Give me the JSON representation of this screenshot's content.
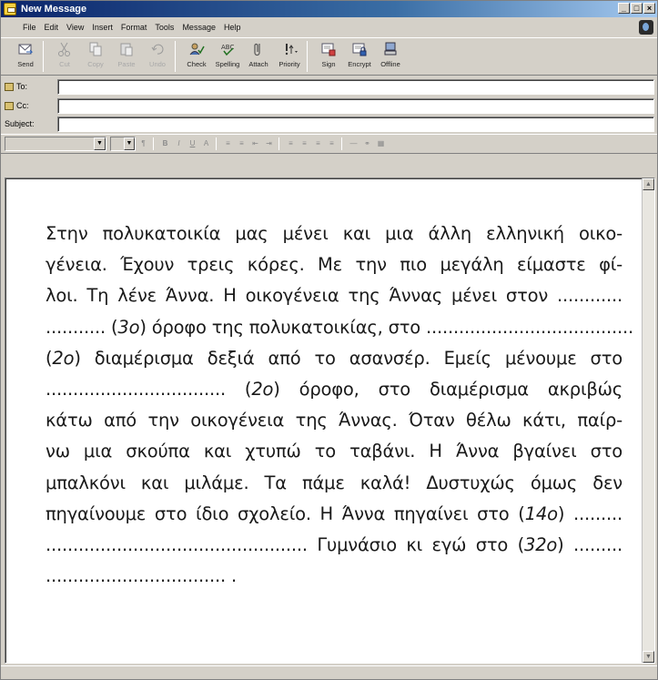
{
  "window": {
    "title": "New Message"
  },
  "menubar": {
    "items": [
      "File",
      "Edit",
      "View",
      "Insert",
      "Format",
      "Tools",
      "Message",
      "Help"
    ]
  },
  "toolbar": {
    "buttons": [
      {
        "label": "Send",
        "icon": "send-icon",
        "enabled": true
      },
      {
        "label": "Cut",
        "icon": "cut-icon",
        "enabled": false
      },
      {
        "label": "Copy",
        "icon": "copy-icon",
        "enabled": false
      },
      {
        "label": "Paste",
        "icon": "paste-icon",
        "enabled": false
      },
      {
        "label": "Undo",
        "icon": "undo-icon",
        "enabled": false
      },
      {
        "label": "Check",
        "icon": "check-names-icon",
        "enabled": true
      },
      {
        "label": "Spelling",
        "icon": "spelling-icon",
        "enabled": true
      },
      {
        "label": "Attach",
        "icon": "attach-icon",
        "enabled": true
      },
      {
        "label": "Priority",
        "icon": "priority-icon",
        "enabled": true
      },
      {
        "label": "Sign",
        "icon": "sign-icon",
        "enabled": true
      },
      {
        "label": "Encrypt",
        "icon": "encrypt-icon",
        "enabled": true
      },
      {
        "label": "Offline",
        "icon": "offline-icon",
        "enabled": true
      }
    ]
  },
  "headers": {
    "to_label": "To:",
    "cc_label": "Cc:",
    "subject_label": "Subject:",
    "to_value": "",
    "cc_value": "",
    "subject_value": ""
  },
  "body": {
    "lines": [
      [
        "Στην πολυκατοικία μας μένει και μια άλλη ελληνική οικο-"
      ],
      [
        "γένεια. Έχουν τρεις κόρες. Με την πιο μεγάλη είμαστε φί-"
      ],
      [
        "λοι. Τη λένε Άννα. Η οικογένεια της Άννας μένει στον ............"
      ],
      [
        "........... (",
        "3ο",
        ") όροφο της πολυκατοικίας, στο ......................................"
      ],
      [
        "(",
        "2ο",
        ") διαμέρισμα δεξιά από το ασανσέρ. Εμείς μένουμε στο"
      ],
      [
        "................................. (",
        "2ο",
        ") όροφο, στο διαμέρισμα ακριβώς"
      ],
      [
        "κάτω από την οικογένεια της Άννας. Όταν θέλω κάτι, παίρ-"
      ],
      [
        "νω μια σκούπα και χτυπώ το ταβάνι. Η Άννα βγαίνει στο"
      ],
      [
        "μπαλκόνι και μιλάμε. Τα πάμε καλά! Δυστυχώς όμως δεν"
      ],
      [
        "πηγαίνουμε στο ίδιο σχολείο. Η Άννα πηγαίνει στο (",
        "14ο",
        ") ........."
      ],
      [
        "................................................ Γυμνάσιο κι εγώ στο (",
        "32ο",
        ") ........."
      ],
      [
        "................................. ."
      ]
    ]
  }
}
